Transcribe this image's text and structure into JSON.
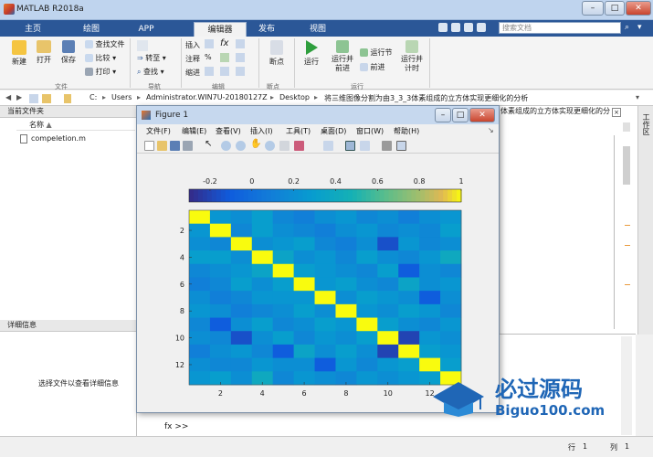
{
  "window": {
    "title": "MATLAB R2018a"
  },
  "tabs": [
    "主页",
    "绘图",
    "APP",
    "编辑器",
    "发布",
    "视图"
  ],
  "active_tab": "编辑器",
  "search": {
    "placeholder": "搜索文档"
  },
  "ribbon": {
    "file": {
      "new": "新建",
      "open": "打开",
      "save": "保存",
      "find_files": "查找文件",
      "compare": "比较",
      "print": "打印",
      "label": "文件"
    },
    "nav": {
      "goto": "转至",
      "find": "查找",
      "label": "导航"
    },
    "edit": {
      "insert": "插入",
      "comment": "注释",
      "indent": "缩进",
      "label": "编辑"
    },
    "breakpoints": {
      "label": "断点"
    },
    "run": {
      "run": "运行",
      "run_advance": "运行并前进",
      "run_section": "运行节",
      "advance": "前进",
      "run_time": "运行并计时",
      "label": "运行"
    }
  },
  "address": {
    "parts": [
      "C:",
      "Users",
      "Administrator.WIN7U-20180127Z",
      "Desktop",
      "将三维图像分割为由3_3_3体素组成的立方体实现更细化的分析"
    ]
  },
  "left": {
    "header": "当前文件夹",
    "col_name": "名称",
    "file": "compeletion.m",
    "details_header": "详细信息",
    "details_hint": "选择文件以查看详细信息"
  },
  "right": {
    "header": "体素组成的立方体实现更细化的分析...",
    "side_label": "工作区"
  },
  "cmd": {
    "prompt": "fx >>"
  },
  "status": {
    "row": "行",
    "row_val": "1",
    "col": "列",
    "col_val": "1"
  },
  "figure": {
    "title": "Figure 1",
    "menu": [
      "文件(F)",
      "编辑(E)",
      "查看(V)",
      "插入(I)",
      "工具(T)",
      "桌面(D)",
      "窗口(W)",
      "帮助(H)"
    ]
  },
  "watermark": {
    "cn": "必过源码",
    "url": "Biguo100.com"
  },
  "colors": {
    "tab_blue": "#2b5797",
    "parula_low": "#352a87",
    "parula_high": "#f9fb0e"
  },
  "chart_data": {
    "type": "heatmap",
    "colorbar_ticks": [
      "-0.2",
      "0",
      "0.2",
      "0.4",
      "0.6",
      "0.8",
      "1"
    ],
    "clim": [
      -0.3,
      1
    ],
    "y_ticks": [
      "2",
      "4",
      "6",
      "8",
      "10",
      "12"
    ],
    "x_ticks": [
      "2",
      "4",
      "6",
      "8",
      "10",
      "12"
    ],
    "matrix": [
      [
        1.0,
        0.25,
        0.2,
        0.3,
        0.15,
        0.1,
        0.2,
        0.25,
        0.15,
        0.2,
        0.1,
        0.2,
        0.25
      ],
      [
        0.25,
        1.0,
        0.15,
        0.3,
        0.2,
        0.15,
        0.1,
        0.2,
        0.25,
        0.15,
        0.2,
        0.15,
        0.3
      ],
      [
        0.2,
        0.15,
        1.0,
        0.2,
        0.25,
        0.3,
        0.15,
        0.1,
        0.2,
        -0.15,
        0.25,
        0.15,
        0.2
      ],
      [
        0.3,
        0.3,
        0.2,
        1.0,
        0.35,
        0.2,
        0.25,
        0.15,
        0.3,
        0.2,
        0.15,
        0.25,
        0.4
      ],
      [
        0.15,
        0.2,
        0.25,
        0.35,
        1.0,
        0.3,
        0.25,
        0.2,
        0.15,
        0.3,
        -0.1,
        0.2,
        0.15
      ],
      [
        0.1,
        0.15,
        0.3,
        0.2,
        0.3,
        1.0,
        0.25,
        0.3,
        0.2,
        0.15,
        0.35,
        0.2,
        0.25
      ],
      [
        0.2,
        0.1,
        0.15,
        0.25,
        0.25,
        0.25,
        1.0,
        0.2,
        0.3,
        0.25,
        0.2,
        -0.1,
        0.2
      ],
      [
        0.25,
        0.2,
        0.1,
        0.15,
        0.2,
        0.3,
        0.2,
        1.0,
        0.25,
        0.2,
        0.3,
        0.25,
        0.15
      ],
      [
        0.15,
        -0.1,
        0.2,
        0.3,
        0.15,
        0.2,
        0.3,
        0.25,
        1.0,
        0.3,
        0.2,
        0.15,
        0.25
      ],
      [
        0.2,
        0.15,
        -0.15,
        0.2,
        0.3,
        0.15,
        0.25,
        0.2,
        0.3,
        1.0,
        -0.2,
        0.25,
        0.2
      ],
      [
        0.1,
        0.2,
        0.25,
        0.15,
        -0.1,
        0.35,
        0.2,
        0.3,
        0.2,
        -0.2,
        1.0,
        0.3,
        0.25
      ],
      [
        0.2,
        0.15,
        0.15,
        0.25,
        0.2,
        0.2,
        -0.1,
        0.25,
        0.15,
        0.25,
        0.3,
        1.0,
        0.3
      ],
      [
        0.25,
        0.3,
        0.2,
        0.4,
        0.15,
        0.25,
        0.2,
        0.15,
        0.25,
        0.2,
        0.25,
        0.3,
        1.0
      ]
    ]
  }
}
